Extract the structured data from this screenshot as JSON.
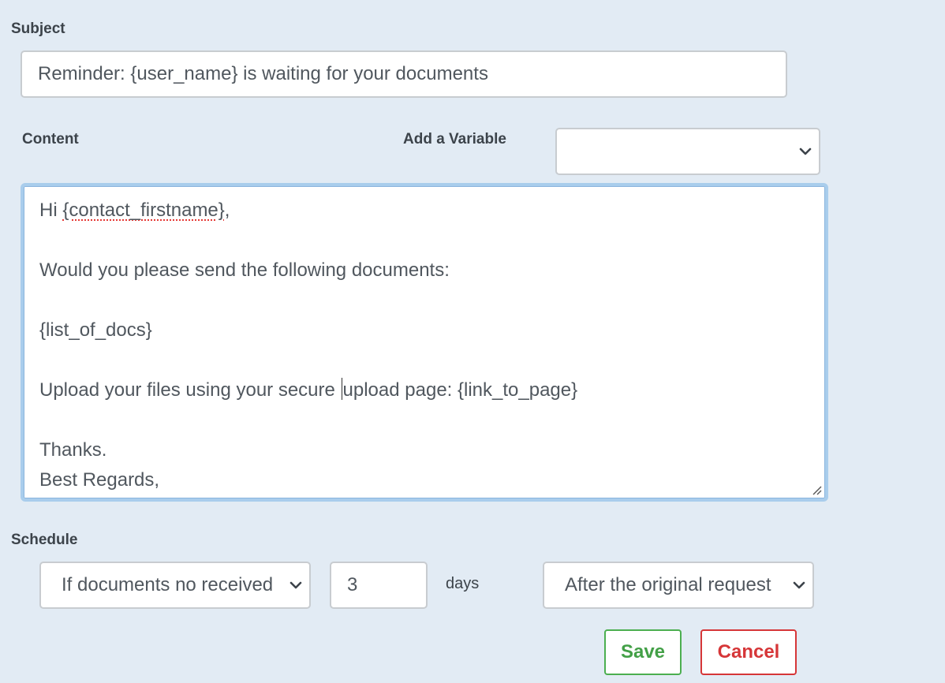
{
  "subject": {
    "label": "Subject",
    "value": "Reminder: {user_name} is waiting for your documents"
  },
  "content": {
    "label": "Content",
    "variable_label": "Add a Variable",
    "variable_value": "",
    "lines": {
      "greeting_prefix": "Hi ",
      "greeting_var": "{contact_firstname}",
      "greeting_suffix": ",",
      "line2": "Would you please send the following documents:",
      "line3": "{list_of_docs}",
      "line4_before_caret": "Upload your files using your secure ",
      "line4_after_caret": "upload page: {link_to_page}",
      "line5": "Thanks.",
      "line6": "Best Regards,"
    }
  },
  "schedule": {
    "label": "Schedule",
    "condition_value": "If documents no received",
    "days_value": "3",
    "days_label": "days",
    "reference_value": "After the original request"
  },
  "buttons": {
    "save": "Save",
    "cancel": "Cancel"
  },
  "colors": {
    "background": "#e2ebf4",
    "save": "#43a047",
    "cancel": "#d63638",
    "focus_border": "#a9cdec"
  },
  "icons": {
    "dropdown": "chevron-down-icon",
    "resize": "resize-handle-icon"
  }
}
